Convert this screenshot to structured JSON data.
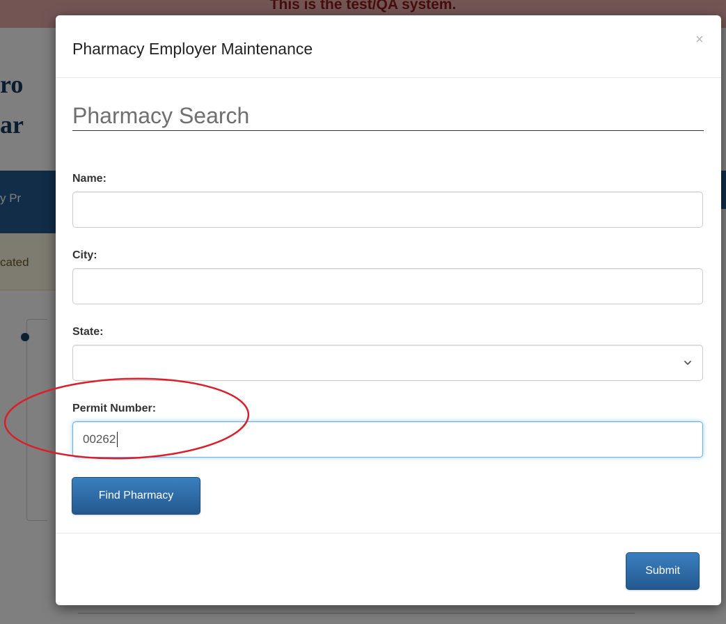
{
  "background": {
    "banner_text": "This is the test/QA system.",
    "header_line1": "ro",
    "header_line2": "ar",
    "nav_item": "y Pr",
    "alert_text": "cated"
  },
  "modal": {
    "title": "Pharmacy Employer Maintenance",
    "close_label": "×",
    "section_title": "Pharmacy Search",
    "fields": {
      "name": {
        "label": "Name:",
        "value": ""
      },
      "city": {
        "label": "City:",
        "value": ""
      },
      "state": {
        "label": "State:",
        "value": ""
      },
      "permit": {
        "label": "Permit Number:",
        "value": "00262"
      }
    },
    "find_button": "Find Pharmacy",
    "submit_button": "Submit"
  },
  "colors": {
    "primary_button": "#23598f",
    "annotation": "#d9202a",
    "focus_border": "#66afe9"
  },
  "icons": {
    "close": "close-icon",
    "select_arrow": "chevron-down-icon"
  }
}
